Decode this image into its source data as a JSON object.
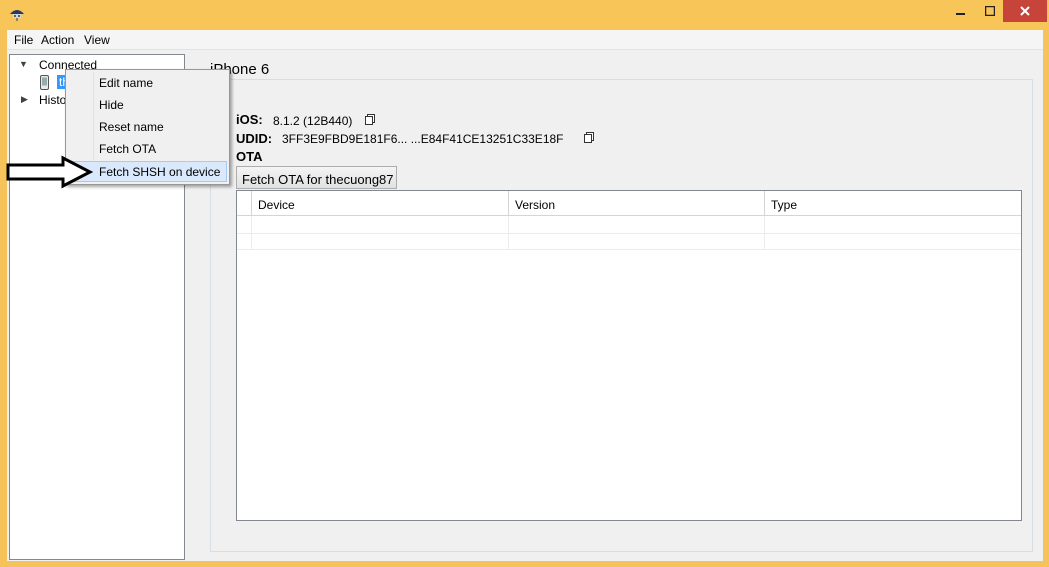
{
  "window": {
    "icon": "umbrella-app-icon",
    "controls": {
      "minimize": "–",
      "maximize": "□",
      "close": "✕"
    }
  },
  "menubar": {
    "file": "File",
    "action": "Action",
    "view": "View"
  },
  "tree": {
    "connected_label": "Connected",
    "device_label": "th",
    "history_label": "Histo"
  },
  "device_panel": {
    "title": "iPhone 6",
    "ios_label": "iOS:",
    "ios_value": "8.1.2 (12B440)",
    "udid_label": "UDID:",
    "udid_value": "3FF3E9FBD9E181F6... ...E84F41CE13251C33E18F",
    "ota_label": "OTA",
    "ota_button": "Fetch OTA for thecuong87"
  },
  "grid": {
    "columns": [
      "Device",
      "Version",
      "Type"
    ]
  },
  "context_menu": {
    "items": [
      "Edit name",
      "Hide",
      "Reset name",
      "Fetch OTA",
      "Fetch SHSH on device"
    ]
  },
  "colors": {
    "titlebar": "#f8c559",
    "close_button": "#c7443a",
    "menu_highlight": "#d9e8fb",
    "selection": "#3399ff"
  }
}
